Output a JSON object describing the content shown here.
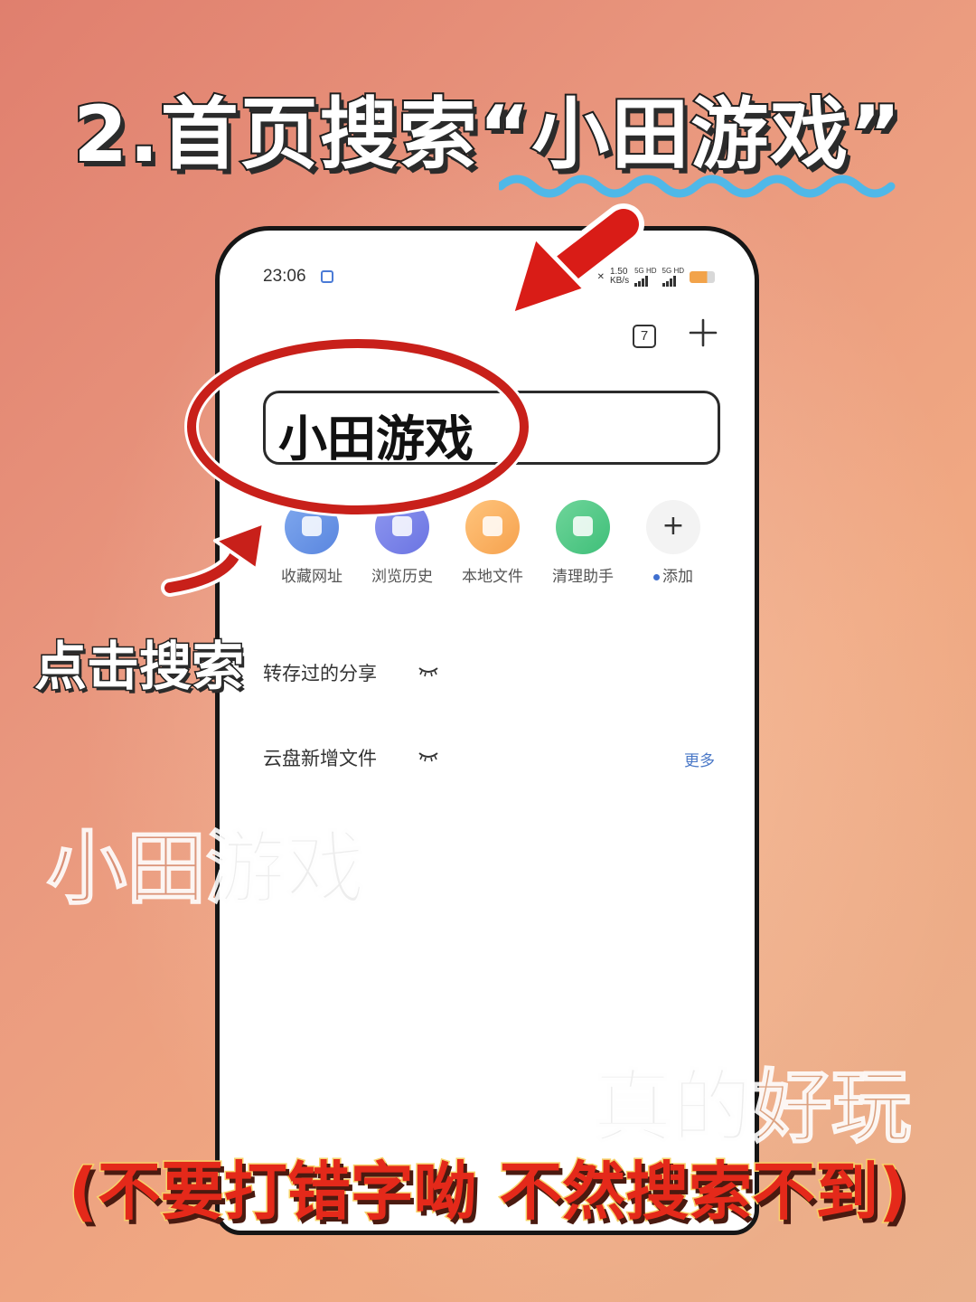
{
  "header": {
    "title": "2.首页搜索“小田游戏”"
  },
  "phone": {
    "status": {
      "time": "23:06",
      "speed_value": "1.50",
      "speed_unit": "KB/s",
      "net1": "5G HD",
      "net2": "5G HD"
    },
    "toolbar": {
      "tab_count": "7",
      "add_tab_icon": "plus-icon"
    },
    "search": {
      "value": "小田游戏"
    },
    "shortcuts": [
      {
        "label": "收藏网址",
        "icon": "bookmark-icon",
        "color": "#5a86df"
      },
      {
        "label": "浏览历史",
        "icon": "history-icon",
        "color": "#6b74e2"
      },
      {
        "label": "本地文件",
        "icon": "folder-icon",
        "color": "#f6a24e"
      },
      {
        "label": "清理助手",
        "icon": "broom-icon",
        "color": "#3fbf79"
      },
      {
        "label": "添加",
        "icon": "plus-icon",
        "color": "#f3f3f3"
      }
    ],
    "sections": {
      "saved_shares": "转存过的分享",
      "cloud_new": "云盘新增文件",
      "more": "更多"
    },
    "watermarks": {
      "wm1": "小田游戏",
      "wm2": "真的好玩"
    }
  },
  "annotations": {
    "tap_label": "点击搜索",
    "footer_note": "(不要打错字呦 不然搜索不到)",
    "highlight_color": "#c8201a",
    "underline_color": "#4fb8e8"
  }
}
